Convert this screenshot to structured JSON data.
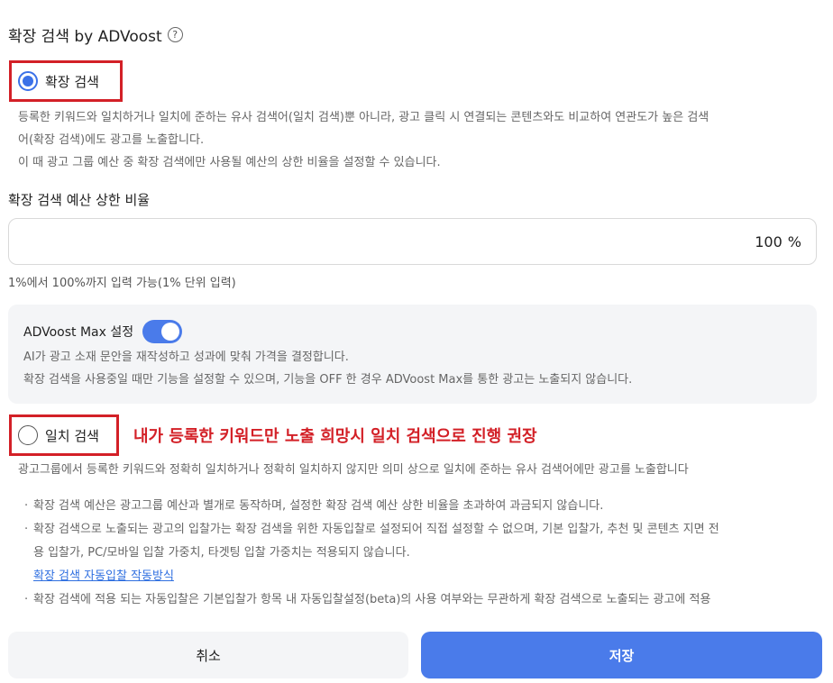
{
  "section": {
    "title": "확장 검색 by ADVoost",
    "help_icon": "?"
  },
  "expand_option": {
    "label": "확장 검색",
    "checked": true,
    "desc_line1": "등록한 키워드와 일치하거나 일치에 준하는 유사 검색어(일치 검색)뿐 아니라, 광고 클릭 시 연결되는 콘텐츠와도 비교하여 연관도가 높은 검색",
    "desc_line2": "어(확장 검색)에도 광고를 노출합니다.",
    "desc_line3": "이 때 광고 그룹 예산 중 확장 검색에만 사용될 예산의 상한 비율을 설정할 수 있습니다."
  },
  "budget": {
    "label": "확장 검색 예산 상한 비율",
    "value": "100",
    "unit": "%",
    "hint": "1%에서 100%까지 입력 가능(1% 단위 입력)"
  },
  "advoost_max": {
    "title": "ADVoost Max 설정",
    "toggle_on": true,
    "desc_line1": "AI가 광고 소재 문안을 재작성하고 성과에 맞춰 가격을 결정합니다.",
    "desc_line2": "확장 검색을 사용중일 때만 기능을 설정할 수 있으며, 기능을 OFF 한 경우 ADVoost Max를 통한 광고는 노출되지 않습니다."
  },
  "exact_option": {
    "label": "일치 검색",
    "checked": false,
    "desc": "광고그룹에서 등록한 키워드와 정확히 일치하거나 정확히 일치하지 않지만 의미 상으로 일치에 준하는 유사 검색어에만 광고를 노출합니다"
  },
  "annotation": {
    "text": "내가 등록한 키워드만 노출 희망시 일치 검색으로 진행 권장",
    "color": "#d32027"
  },
  "bullets": {
    "b1": "확장 검색 예산은 광고그룹 예산과 별개로 동작하며, 설정한 확장 검색 예산 상한 비율을 초과하여 과금되지 않습니다.",
    "b2_line1": "확장 검색으로 노출되는 광고의 입찰가는 확장 검색을 위한 자동입찰로 설정되어 직접 설정할 수 없으며, 기본 입찰가, 추천 및 콘텐츠 지면 전",
    "b2_line2": "용 입찰가, PC/모바일 입찰 가중치, 타겟팅 입찰 가중치는 적용되지 않습니다.",
    "link": "확장 검색 자동입찰 작동방식",
    "b3": "확장 검색에 적용 되는 자동입찰은 기본입찰가 항목 내 자동입찰설정(beta)의 사용 여부와는 무관하게 확장 검색으로 노출되는 광고에 적용"
  },
  "footer": {
    "cancel_label": "취소",
    "save_label": "저장"
  },
  "colors": {
    "accent": "#4a7bea",
    "highlight": "#d32027"
  }
}
